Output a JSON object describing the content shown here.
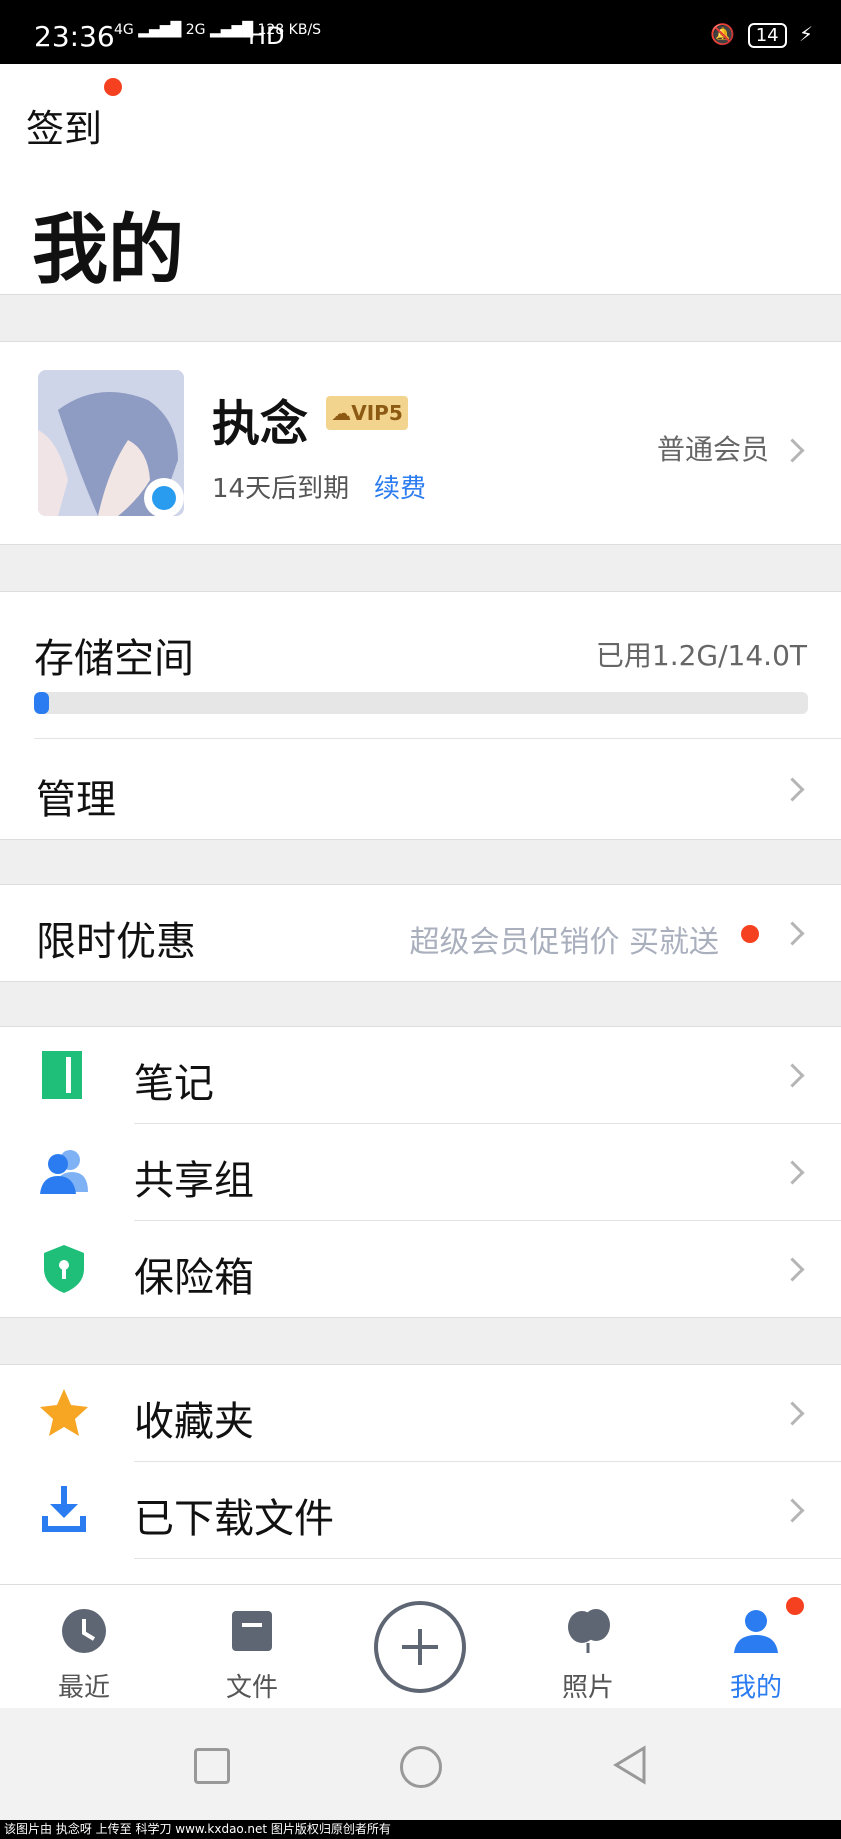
{
  "status_bar": {
    "time": "23:36",
    "network_top": "4G",
    "network_bottom": "2G",
    "speed_value": "128",
    "speed_unit": "KB/S",
    "hd": "HD",
    "battery": "14"
  },
  "header": {
    "checkin": "签到",
    "title": "我的"
  },
  "profile": {
    "username": "执念",
    "vip": "VIP5",
    "expiry": "14天后到期",
    "renew": "续费",
    "member_level": "普通会员"
  },
  "storage": {
    "label": "存储空间",
    "used_text": "已用1.2G/14.0T",
    "used_fraction": 0.02
  },
  "manage": {
    "label": "管理"
  },
  "promo": {
    "label": "限时优惠",
    "text": "超级会员促销价 买就送"
  },
  "menu_group1": [
    {
      "label": "笔记",
      "icon": "note-icon"
    },
    {
      "label": "共享组",
      "icon": "group-icon"
    },
    {
      "label": "保险箱",
      "icon": "safe-icon"
    }
  ],
  "menu_group2": [
    {
      "label": "收藏夹",
      "icon": "star-icon"
    },
    {
      "label": "已下载文件",
      "icon": "download-icon"
    }
  ],
  "tabbar": {
    "recent": "最近",
    "files": "文件",
    "photos": "照片",
    "mine": "我的"
  },
  "colors": {
    "accent": "#2a7cf0",
    "badge": "#f5411f",
    "note": "#1fbf7a",
    "star": "#f6a623"
  },
  "footer": "该图片由 执念呀 上传至 科学刀 www.kxdao.net 图片版权归原创者所有"
}
